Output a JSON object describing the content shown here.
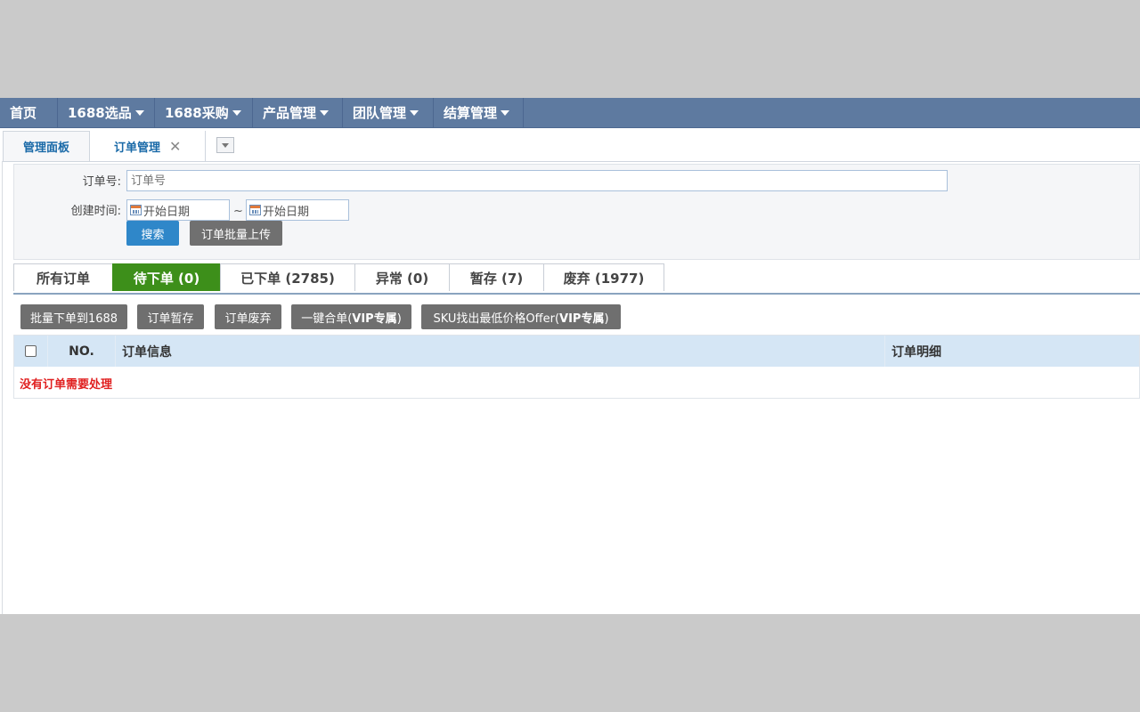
{
  "topnav": {
    "items": [
      {
        "label": "首页",
        "has_menu": false
      },
      {
        "label": "1688选品",
        "has_menu": true
      },
      {
        "label": "1688采购",
        "has_menu": true
      },
      {
        "label": "产品管理",
        "has_menu": true
      },
      {
        "label": "团队管理",
        "has_menu": true
      },
      {
        "label": "结算管理",
        "has_menu": true
      }
    ]
  },
  "tabs": {
    "dashboard": "管理面板",
    "orders": "订单管理",
    "close_glyph": "✕"
  },
  "search": {
    "order_no_label": "订单号:",
    "order_no_placeholder": "订单号",
    "created_label": "创建时间:",
    "start_date_placeholder": "开始日期",
    "end_date_placeholder": "开始日期",
    "range_sep": "~",
    "search_button": "搜索",
    "upload_button": "订单批量上传"
  },
  "status_tabs": [
    {
      "label": "所有订单",
      "active": false
    },
    {
      "label": "待下单 (0)",
      "active": true
    },
    {
      "label": "已下单 (2785)",
      "active": false
    },
    {
      "label": "异常 (0)",
      "active": false
    },
    {
      "label": "暂存 (7)",
      "active": false
    },
    {
      "label": "废弃 (1977)",
      "active": false
    }
  ],
  "actions": {
    "batch_order": "批量下单到1688",
    "hold": "订单暂存",
    "discard": "订单废弃",
    "merge_prefix": "一键合单(",
    "merge_vip": "VIP专属",
    "merge_suffix": ")",
    "sku_prefix": "SKU找出最低价格Offer(",
    "sku_vip": "VIP专属",
    "sku_suffix": ")"
  },
  "table": {
    "col_no": "NO.",
    "col_info": "订单信息",
    "col_detail": "订单明细",
    "empty_message": "没有订单需要处理"
  },
  "colors": {
    "nav_bg": "#5e7aa0",
    "active_tab": "#3d8f1a",
    "primary_button": "#2f87c9",
    "gray_button": "#6f6f6f",
    "table_header": "#d5e6f5",
    "empty_text": "#e01f1f"
  }
}
